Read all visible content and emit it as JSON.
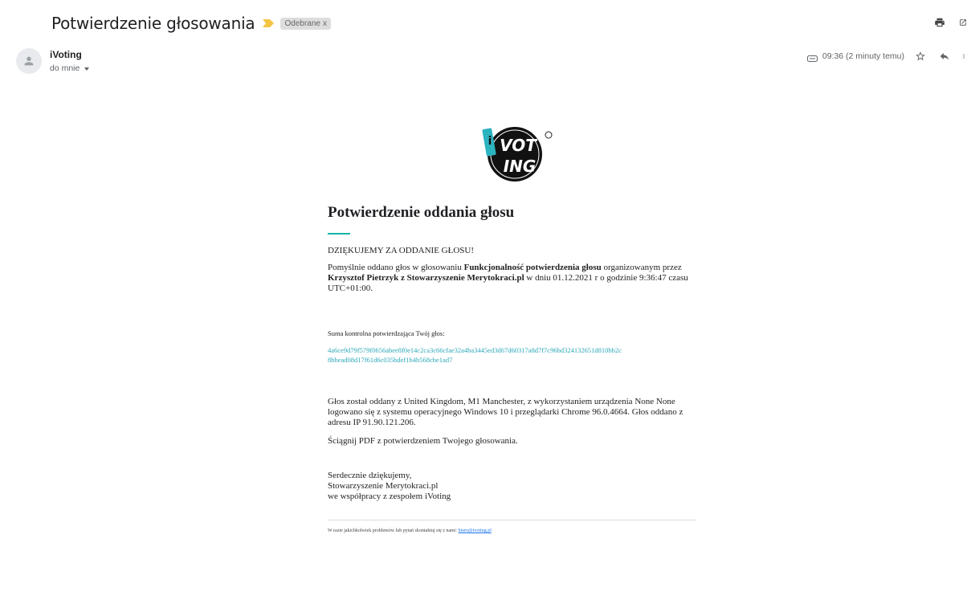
{
  "header": {
    "subject": "Potwierdzenie głosowania",
    "label_chip": "Odebrane",
    "label_chip_close": "x"
  },
  "toolbar": {
    "print_icon": "printer-icon",
    "open_new_window_icon": "open-in-new-icon"
  },
  "sender": {
    "name": "iVoting",
    "recipient": "do mnie"
  },
  "meta": {
    "time": "09:36 (2 minuty temu)",
    "star_icon": "star-icon",
    "reply_icon": "reply-icon",
    "more_icon": "more-vert-icon"
  },
  "email": {
    "logo_text_top": "VOT",
    "logo_text_bottom": "ING",
    "logo_i": "i",
    "heading": "Potwierdzenie oddania głosu",
    "thanks": "DZIĘKUJEMY ZA ODDANIE GŁOSU!",
    "p1_prefix": "Pomyślnie oddano głos w głosowaniu ",
    "p1_vote_name": "Funkcjonalność potwierdzenia głosu",
    "p1_mid": " organizowanym przez ",
    "p1_organizer": "Krzysztof Pietrzyk z Stowarzyszenie Merytokraci.pl",
    "p1_suffix": " w dniu 01.12.2021 r o godzinie 9:36:47 czasu UTC+01:00.",
    "checksum_label": "Suma kontrolna potwierdzająca Twój głos:",
    "checksum_line1": "4a6ce9d79f579f0656abee8f0e14c2ca3c66cfae32a4ba3445ed3d67d60317a8d7f7c96bd324132651d810bb2c",
    "checksum_line2": "8bbead08d17f61d6c035bdef1b4b568cbe1ad7",
    "geo_text": "Głos został oddany z United Kingdom, M1 Manchester, z wykorzystaniem urządzenia None None logowano się z systemu operacyjnego Windows 10 i przeglądarki Chrome 96.0.4664. Głos oddano z adresu IP 91.90.121.206.",
    "pdf_text": "Ściągnij PDF z potwierdzeniem Twojego głosowania.",
    "signoff_line1": "Serdecznie dziękujemy,",
    "signoff_line2": "Stowarzyszenie Merytokraci.pl",
    "signoff_line3": "we współpracy z zespołem iVoting",
    "footer_text": "W razie jakichkolwiek problemów lub pytań skontaktuj się z nami: ",
    "footer_email": "biuro@ivoting.pl"
  },
  "colors": {
    "accent_teal": "#16b3a8",
    "checksum_color": "#2aa7b8",
    "importance_marker": "#f4c542",
    "link_blue": "#1a73e8"
  }
}
